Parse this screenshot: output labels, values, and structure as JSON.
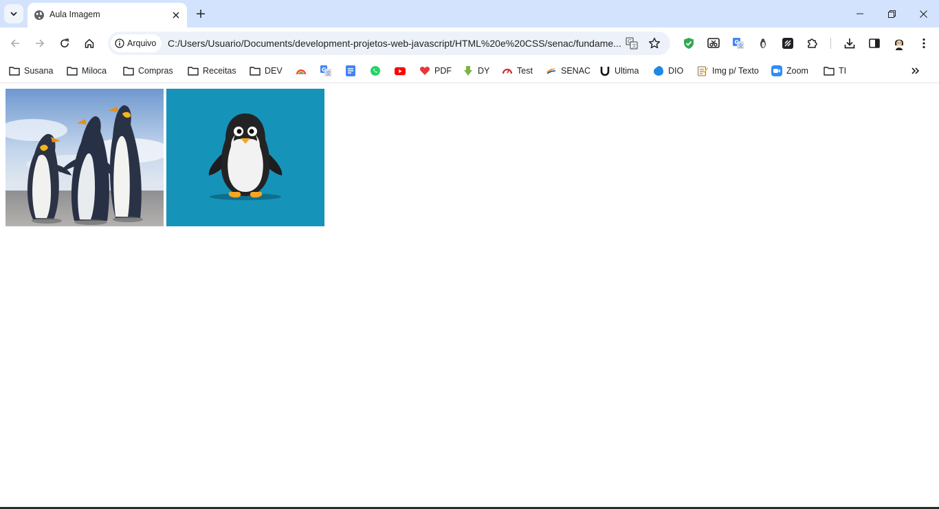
{
  "browser": {
    "tab": {
      "title": "Aula Imagem"
    },
    "address": {
      "site_chip": "Arquivo",
      "url": "C:/Users/Usuario/Documents/development-projetos-web-javascript/HTML%20e%20CSS/senac/fundame..."
    },
    "bookmarks": [
      {
        "label": "Susana",
        "icon": "folder-icon"
      },
      {
        "label": "Miloca",
        "icon": "folder-icon"
      },
      {
        "label": "Compras",
        "icon": "folder-icon"
      },
      {
        "label": "Receitas",
        "icon": "folder-icon"
      },
      {
        "label": "DEV",
        "icon": "folder-icon"
      },
      {
        "label": "",
        "icon": "rainbow-icon"
      },
      {
        "label": "",
        "icon": "google-translate-icon"
      },
      {
        "label": "",
        "icon": "google-docs-icon"
      },
      {
        "label": "",
        "icon": "whatsapp-icon"
      },
      {
        "label": "",
        "icon": "youtube-icon"
      },
      {
        "label": "PDF",
        "icon": "pdf-heart-icon"
      },
      {
        "label": "DY",
        "icon": "download-arrow-icon"
      },
      {
        "label": "Test",
        "icon": "speed-test-icon"
      },
      {
        "label": "SENAC",
        "icon": "senac-icon"
      },
      {
        "label": "Ultima",
        "icon": "ultima-icon"
      },
      {
        "label": "DIO",
        "icon": "dio-icon"
      },
      {
        "label": "Img p/ Texto",
        "icon": "notepad-icon"
      },
      {
        "label": "Zoom",
        "icon": "zoom-icon"
      },
      {
        "label": "TI",
        "icon": "folder-icon"
      }
    ]
  },
  "colors": {
    "tabstrip": "#d3e3fd",
    "omnibox": "#edf2fa",
    "penguin_bg": "#1693b8"
  },
  "page": {
    "images": [
      {
        "name": "penguins-photo"
      },
      {
        "name": "penguin-cartoon"
      }
    ]
  }
}
